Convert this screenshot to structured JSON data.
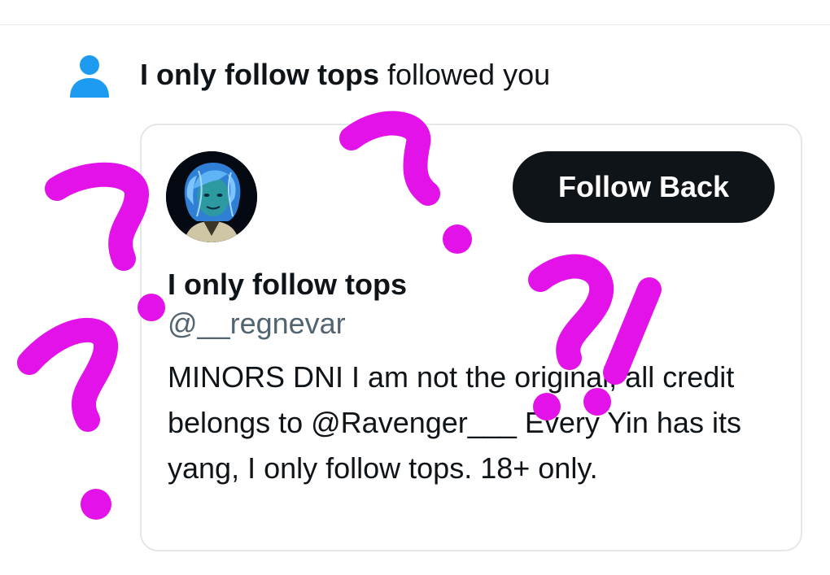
{
  "notification": {
    "actor_name": "I only follow tops",
    "action_text": " followed you",
    "icon": "person-icon"
  },
  "profile_card": {
    "display_name": "I only follow tops",
    "handle": "@__regnevar",
    "bio": "MINORS DNI I am not the original, all credit belongs to @Ravenger___ Every Yin has its yang, I only follow tops. 18+ only.",
    "follow_button_label": "Follow Back"
  },
  "colors": {
    "accent_blue": "#1d9bf0",
    "button_bg": "#0f1419",
    "text_secondary": "#536471",
    "annotation_magenta": "#e312e8"
  },
  "annotations": {
    "marks": [
      "?",
      "?",
      "?",
      "?",
      "!"
    ]
  }
}
